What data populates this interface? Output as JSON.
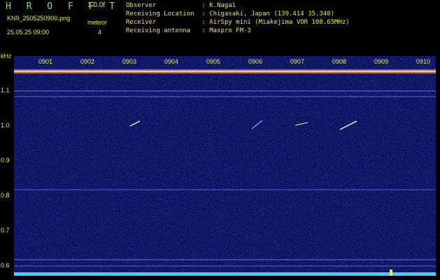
{
  "header": {
    "app_title": "H R O F F T",
    "version": "1.0.0f",
    "file_name": "KN9_2505250900.png",
    "date_time": "25.05.25 09:00",
    "meteor_label": "meteor",
    "meteor_count": "4",
    "info": [
      {
        "label": "Observer            :",
        "value": "K.Nagai"
      },
      {
        "label": "Receiving Location  :",
        "value": "Chigasaki, Japan (139.414 35.340)"
      },
      {
        "label": "Receiver            :",
        "value": "AirSpy mini (Miakejima VOR 108.65MHz)"
      },
      {
        "label": "Receiving antenna   :",
        "value": "Maspro FM-3"
      }
    ]
  },
  "plot": {
    "y_unit": "kHz",
    "y_ticks": [
      "1.1",
      "1.0",
      "0.9",
      "0.8",
      "0.7",
      "0.6"
    ],
    "x_labels": [
      "0901",
      "0902",
      "0903",
      "0904",
      "0905",
      "0906",
      "0907",
      "0908",
      "0909",
      "0910"
    ],
    "colors": {
      "background": "#0a1160",
      "text": "#e8e84a",
      "title": "#6fe66f",
      "carrier": "#ff8080",
      "floor": "#3fd0f0"
    }
  }
}
